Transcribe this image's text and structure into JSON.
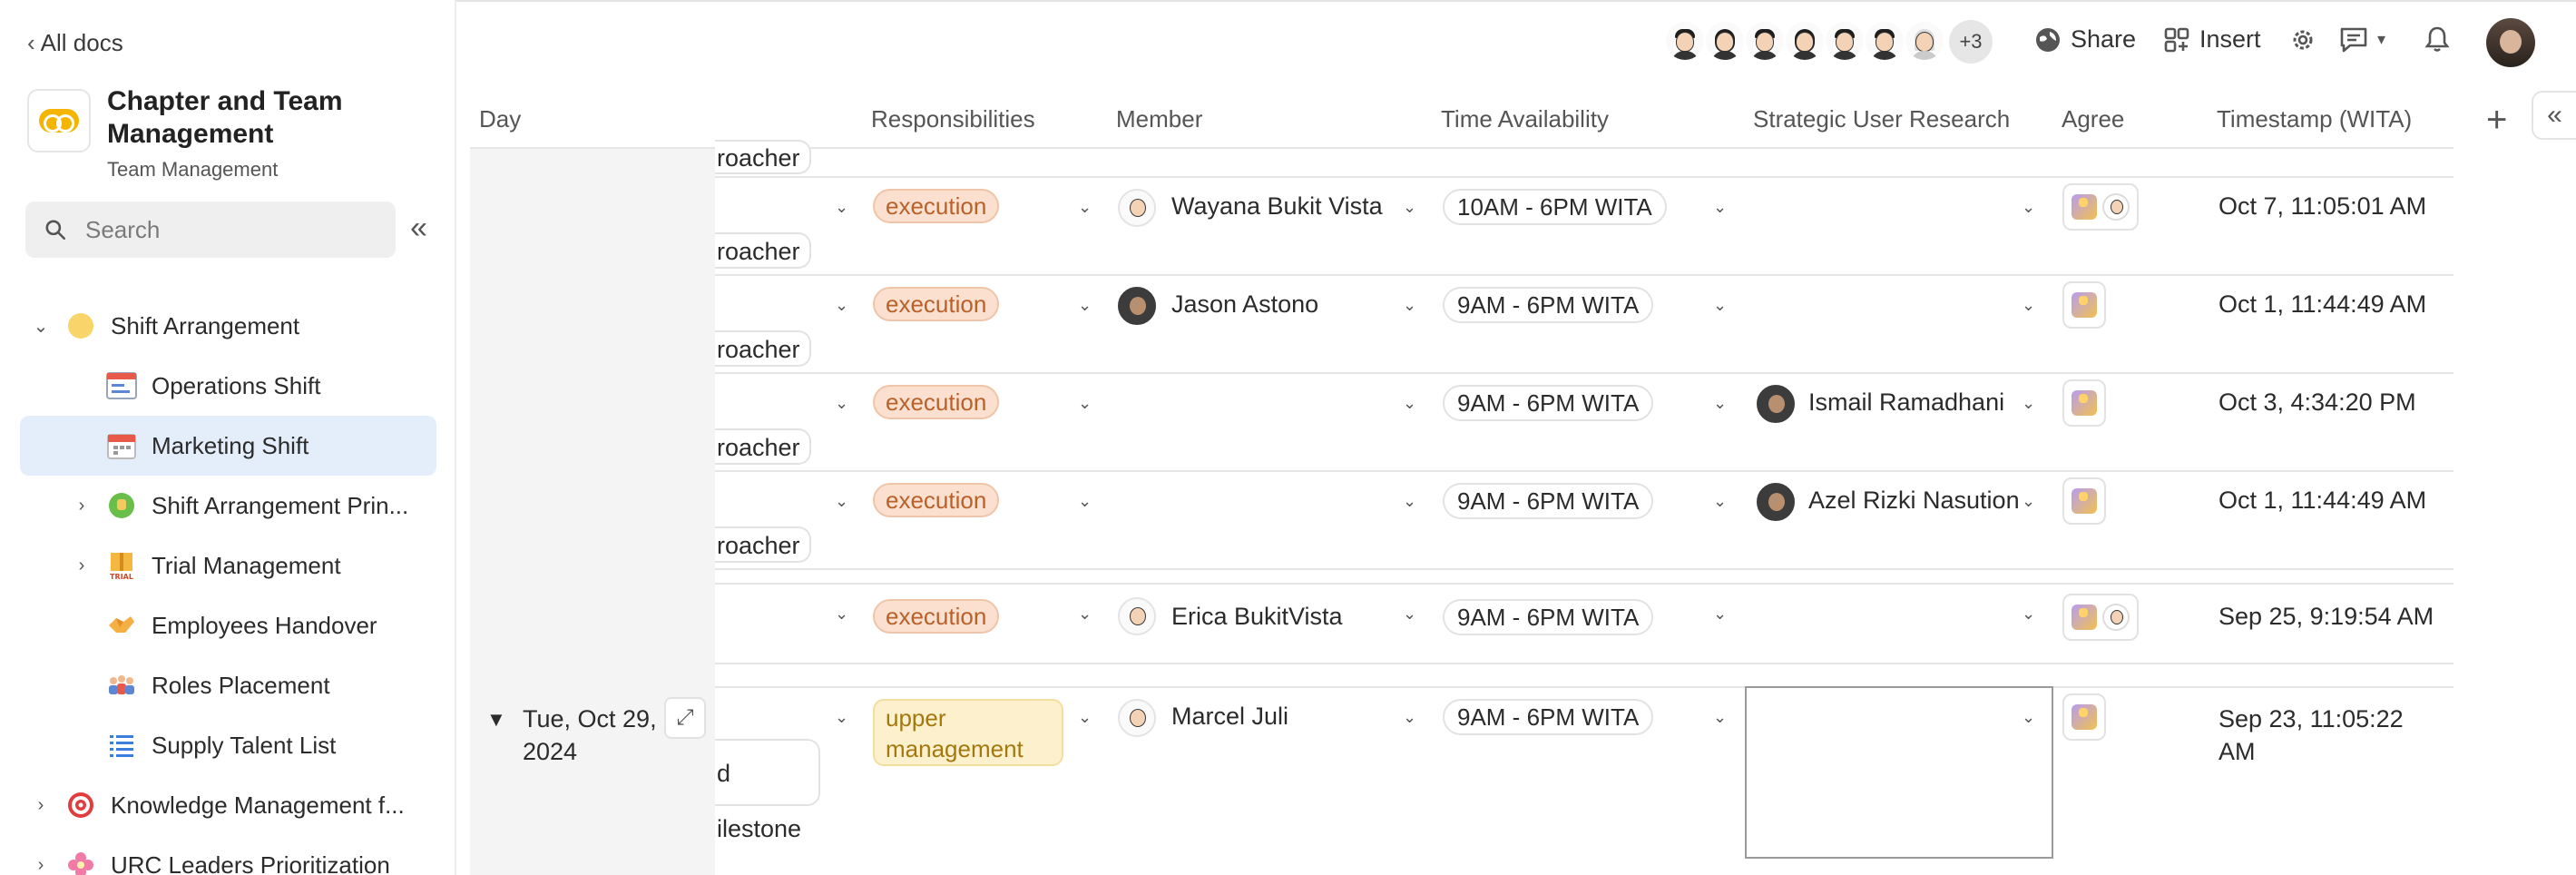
{
  "sidebar": {
    "back_label": "All docs",
    "doc_title": "Chapter and Team Management",
    "doc_subtitle": "Team Management",
    "search_placeholder": "Search",
    "items": [
      {
        "label": "Shift Arrangement",
        "icon": "yellow-circle-icon",
        "level": 0,
        "caret": "expanded"
      },
      {
        "label": "Operations Shift",
        "icon": "table-icon",
        "level": 1,
        "caret": "none"
      },
      {
        "label": "Marketing Shift",
        "icon": "calendar-icon",
        "level": 1,
        "caret": "none",
        "active": true
      },
      {
        "label": "Shift Arrangement Prin...",
        "icon": "green-thumb-icon",
        "level": 1,
        "caret": "collapsed"
      },
      {
        "label": "Trial Management",
        "icon": "trial-box-icon",
        "level": 1,
        "caret": "collapsed"
      },
      {
        "label": "Employees Handover",
        "icon": "handshake-icon",
        "level": 1,
        "caret": "none"
      },
      {
        "label": "Roles Placement",
        "icon": "people-icon",
        "level": 1,
        "caret": "none"
      },
      {
        "label": "Supply Talent List",
        "icon": "list-icon",
        "level": 1,
        "caret": "none"
      },
      {
        "label": "Knowledge Management f...",
        "icon": "target-icon",
        "level": 0,
        "caret": "collapsed"
      },
      {
        "label": "URC Leaders Prioritization",
        "icon": "pink-flower-icon",
        "level": 0,
        "caret": "collapsed"
      }
    ]
  },
  "topbar": {
    "extra_collaborators": "+3",
    "share_label": "Share",
    "insert_label": "Insert"
  },
  "table": {
    "columns": {
      "day": "Day",
      "responsibilities": "Responsibilities",
      "member": "Member",
      "time": "Time Availability",
      "research": "Strategic User Research",
      "agree": "Agree",
      "timestamp": "Timestamp (WITA)"
    },
    "clipped_role": "roacher",
    "rows": [
      {
        "responsibility": "execution",
        "member": "Wayana Bukit Vista",
        "time": "10AM - 6PM WITA",
        "research": "",
        "timestamp": "Oct 7, 11:05:01 AM"
      },
      {
        "responsibility": "execution",
        "member": "Jason Astono",
        "time": "9AM - 6PM WITA",
        "research": "",
        "timestamp": "Oct 1, 11:44:49 AM"
      },
      {
        "responsibility": "execution",
        "member": "",
        "time": "9AM - 6PM WITA",
        "research": "Ismail Ramadhani",
        "timestamp": "Oct 3, 4:34:20 PM"
      },
      {
        "responsibility": "execution",
        "member": "",
        "time": "9AM - 6PM WITA",
        "research": "Azel Rizki Nasution",
        "timestamp": "Oct 1, 11:44:49 AM"
      },
      {
        "responsibility": "execution",
        "member": "Erica BukitVista",
        "time": "9AM - 6PM WITA",
        "research": "",
        "timestamp": "Sep 25, 9:19:54 AM"
      }
    ],
    "group": {
      "day": "Tue, Oct 29, 2024",
      "responsibility": "upper management",
      "member": "Marcel Juli",
      "time": "9AM - 6PM WITA",
      "timestamp": "Sep 23, 11:05:22 AM",
      "clipped_1": "d",
      "clipped_2": "ilestone"
    }
  }
}
